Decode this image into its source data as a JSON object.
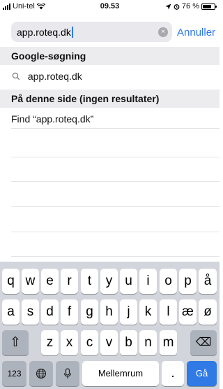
{
  "status": {
    "carrier": "Uni-tel",
    "time": "09.53",
    "battery_text": "76 %",
    "battery_level": 0.76
  },
  "search": {
    "url_value": "app.roteq.dk",
    "cancel_label": "Annuller",
    "clear_glyph": "×"
  },
  "sections": {
    "google_header": "Google-søgning",
    "google_suggestion": "app.roteq.dk",
    "page_header": "På denne side (ingen resultater)",
    "find_text": "Find “app.roteq.dk”"
  },
  "keyboard": {
    "row1": [
      "q",
      "w",
      "e",
      "r",
      "t",
      "y",
      "u",
      "i",
      "o",
      "p",
      "å"
    ],
    "row2": [
      "a",
      "s",
      "d",
      "f",
      "g",
      "h",
      "j",
      "k",
      "l",
      "æ",
      "ø"
    ],
    "row3": [
      "z",
      "x",
      "c",
      "v",
      "b",
      "n",
      "m"
    ],
    "numbers_label": "123",
    "space_label": "Mellemrum",
    "period_label": ".",
    "go_label": "Gå",
    "shift_glyph": "⇧",
    "backspace_glyph": "⌫",
    "globe_glyph": "🌐",
    "mic_glyph": "🎙"
  },
  "colors": {
    "accent": "#2f79e8",
    "go_key": "#2f7ae5",
    "keyboard_bg": "#d2d5db",
    "section_bg": "#ececef"
  }
}
